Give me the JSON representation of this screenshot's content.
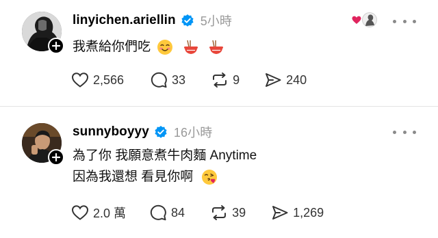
{
  "posts": [
    {
      "username": "linyichen.ariellin",
      "time": "5小時",
      "text_lines": [
        "我煮給你們吃"
      ],
      "stats": {
        "likes": "2,566",
        "comments": "33",
        "reposts": "9",
        "shares": "240"
      }
    },
    {
      "username": "sunnyboyyy",
      "time": "16小時",
      "text_lines": [
        "為了你 我願意煮牛肉麵 Anytime",
        "因為我還想 看見你啊"
      ],
      "stats": {
        "likes": "2.0 萬",
        "comments": "84",
        "reposts": "39",
        "shares": "1,269"
      }
    }
  ],
  "colors": {
    "verified": "#0095f6",
    "secondary_text": "#999999",
    "icon": "#333333",
    "divider": "#e3e3e3",
    "reaction_heart": "#e0245e"
  },
  "icons": [
    "follow-plus-icon",
    "verified-badge-icon",
    "more-options-icon",
    "heart-icon",
    "comment-icon",
    "repost-icon",
    "share-icon",
    "smiling-face-emoji",
    "noodle-bowl-emoji",
    "face-blowing-kiss-emoji"
  ]
}
